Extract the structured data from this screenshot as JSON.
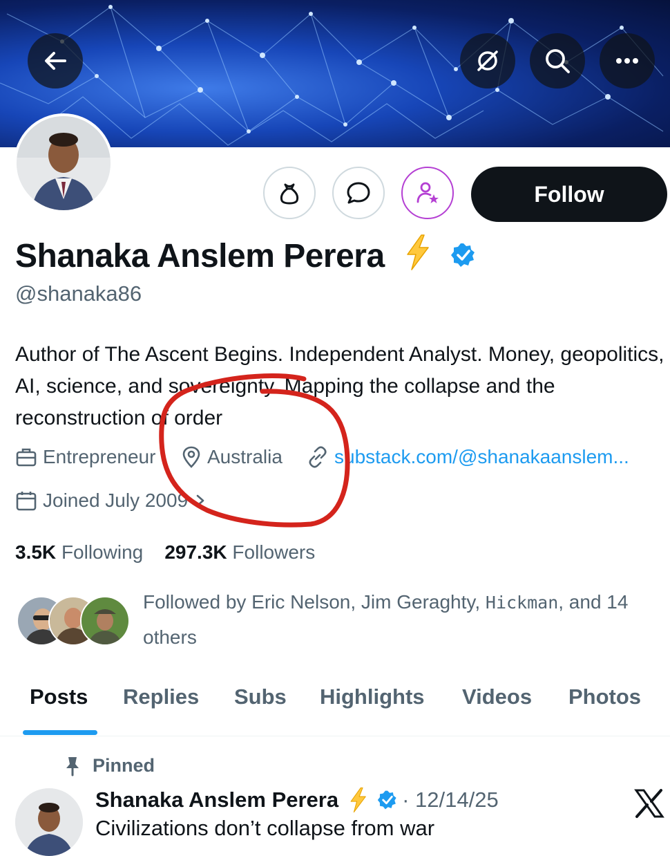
{
  "profile": {
    "name": "Shanaka Anslem Perera",
    "handle": "@shanaka86",
    "bio": "Author of The Ascent Begins. Independent Analyst. Money, geopolitics, AI, science, and sovereignty. Mapping the collapse and the reconstruction of order",
    "profession": "Entrepreneur",
    "location": "Australia",
    "website": "substack.com/@shanakaanslem...",
    "joined": "Joined July 2009"
  },
  "actions": {
    "follow_label": "Follow"
  },
  "stats": {
    "following_count": "3.5K",
    "following_label": "Following",
    "followers_count": "297.3K",
    "followers_label": "Followers"
  },
  "followed_by": {
    "prefix": "Followed by Eric Nelson, Jim Geraghty, ",
    "mono_name": "Hickman",
    "suffix": ", and 14 others"
  },
  "tabs": [
    {
      "label": "Posts"
    },
    {
      "label": "Replies"
    },
    {
      "label": "Subs"
    },
    {
      "label": "Highlights"
    },
    {
      "label": "Videos"
    },
    {
      "label": "Photos"
    }
  ],
  "pinned_post": {
    "pinned_label": "Pinned",
    "author": "Shanaka Anslem Perera",
    "date": "· 12/14/25",
    "text": "Civilizations don’t collapse from war"
  },
  "colors": {
    "accent": "#1d9bf0",
    "verified": "#1d9bf0",
    "subscribe_ring": "#b43fd3",
    "annotation": "#d4241c"
  }
}
